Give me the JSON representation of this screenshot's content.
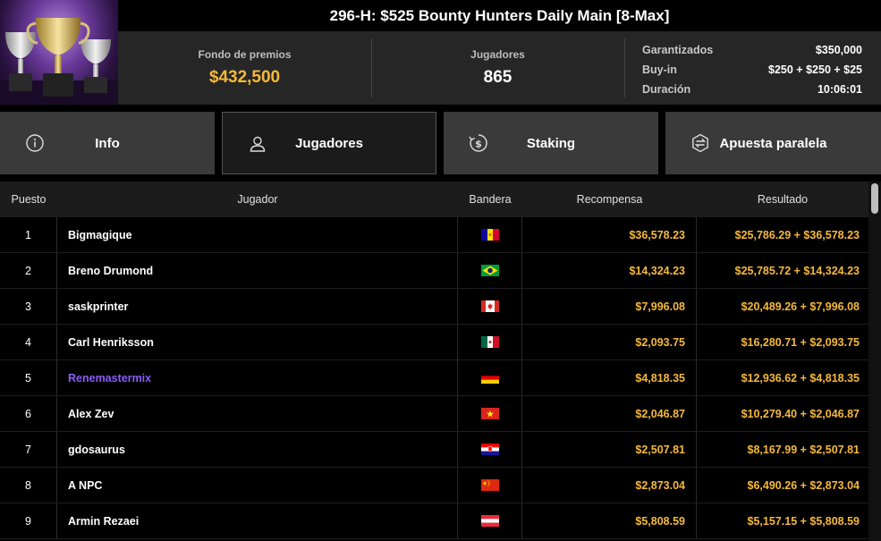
{
  "header": {
    "title": "296-H: $525 Bounty Hunters Daily Main [8-Max]",
    "prize_pool_label": "Fondo de premios",
    "prize_pool_value": "$432,500",
    "players_label": "Jugadores",
    "players_value": "865",
    "details": [
      {
        "label": "Garantizados",
        "value": "$350,000"
      },
      {
        "label": "Buy-in",
        "value": "$250 + $250 + $25"
      },
      {
        "label": "Duración",
        "value": "10:06:01"
      }
    ]
  },
  "tabs": [
    {
      "label": "Info",
      "icon": "info-icon",
      "active": false
    },
    {
      "label": "Jugadores",
      "icon": "user-icon",
      "active": true
    },
    {
      "label": "Staking",
      "icon": "dollar-icon",
      "active": false
    },
    {
      "label": "Apuesta paralela",
      "icon": "bet-icon",
      "active": false
    }
  ],
  "table": {
    "headers": {
      "position": "Puesto",
      "player": "Jugador",
      "flag": "Bandera",
      "reward": "Recompensa",
      "result": "Resultado"
    },
    "rows": [
      {
        "position": "1",
        "player": "Bigmagique",
        "flag": "andorra",
        "reward": "$36,578.23",
        "result": "$25,786.29 + $36,578.23"
      },
      {
        "position": "2",
        "player": "Breno Drumond",
        "flag": "brazil",
        "reward": "$14,324.23",
        "result": "$25,785.72 + $14,324.23"
      },
      {
        "position": "3",
        "player": "saskprinter",
        "flag": "canada",
        "reward": "$7,996.08",
        "result": "$20,489.26 + $7,996.08"
      },
      {
        "position": "4",
        "player": "Carl Henriksson",
        "flag": "mexico",
        "reward": "$2,093.75",
        "result": "$16,280.71 + $2,093.75"
      },
      {
        "position": "5",
        "player": "Renemastermix",
        "flag": "germany",
        "reward": "$4,818.35",
        "result": "$12,936.62 + $4,818.35",
        "highlight": true
      },
      {
        "position": "6",
        "player": "Alex Zev",
        "flag": "vietnam",
        "reward": "$2,046.87",
        "result": "$10,279.40 + $2,046.87"
      },
      {
        "position": "7",
        "player": "gdosaurus",
        "flag": "croatia",
        "reward": "$2,507.81",
        "result": "$8,167.99 + $2,507.81"
      },
      {
        "position": "8",
        "player": "A NPC",
        "flag": "china",
        "reward": "$2,873.04",
        "result": "$6,490.26 + $2,873.04"
      },
      {
        "position": "9",
        "player": "Armin Rezaei",
        "flag": "austria",
        "reward": "$5,808.59",
        "result": "$5,157.15 + $5,808.59"
      }
    ]
  },
  "colors": {
    "gold": "#f5b93a",
    "highlight": "#8b5cf6",
    "panel": "#262626",
    "tab": "#3a3a3a"
  }
}
